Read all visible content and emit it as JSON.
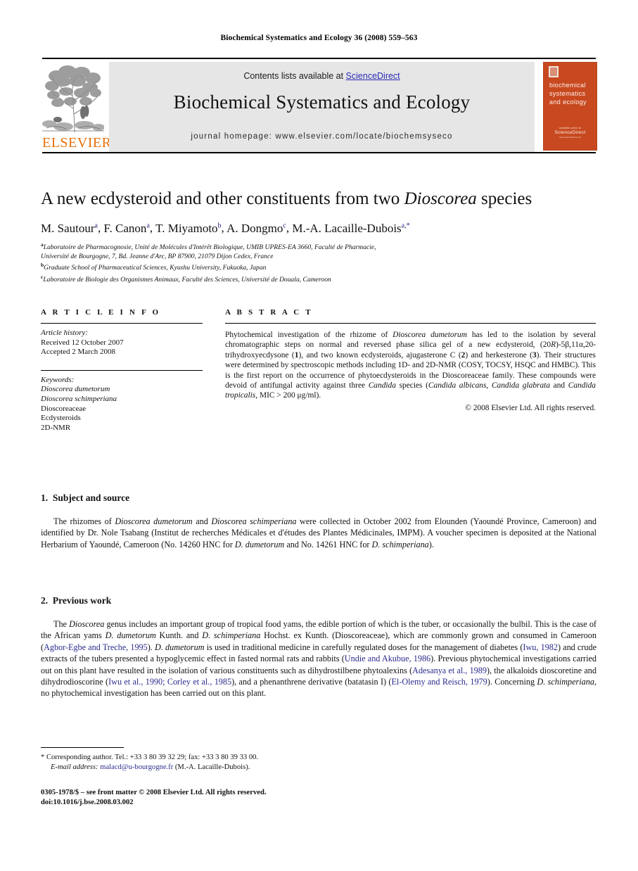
{
  "running_head": "Biochemical Systematics and Ecology 36 (2008) 559–563",
  "masthead": {
    "contents_prefix": "Contents lists available at ",
    "sciencedirect": "ScienceDirect",
    "journal_title": "Biochemical Systematics and Ecology",
    "homepage": "journal homepage: www.elsevier.com/locate/biochemsyseco",
    "publisher_name": "ELSEVIER",
    "cover": {
      "title": "biochemical systematics and ecology",
      "foot_top": "available online at",
      "foot_sd": "ScienceDirect",
      "foot_bottom": "www.sciencedirect.com"
    },
    "colors": {
      "elsevier_orange": "#e8700a",
      "panel_grey": "#e6e6e6",
      "link_blue": "#2b2bb5",
      "cover_orange": "#c8491f"
    }
  },
  "article": {
    "title_part1": "A new ecdysteroid and other constituents from two ",
    "title_italic": "Dioscorea",
    "title_part2": " species",
    "authors": [
      {
        "name": "M. Sautour",
        "sup": "a"
      },
      {
        "name": "F. Canon",
        "sup": "a"
      },
      {
        "name": "T. Miyamoto",
        "sup": "b"
      },
      {
        "name": "A. Dongmo",
        "sup": "c"
      },
      {
        "name": "M.-A. Lacaille-Dubois",
        "sup": "a,*"
      }
    ],
    "affiliations": [
      {
        "sup": "a",
        "text": "Laboratoire de Pharmacognosie, Unité de Molécules d'Intérêt Biologique, UMIB UPRES-EA 3660, Faculté de Pharmacie,"
      },
      {
        "sup": "",
        "text": "Université de Bourgogne, 7, Bd. Jeanne d'Arc, BP 87900, 21079 Dijon Cedex, France"
      },
      {
        "sup": "b",
        "text": "Graduate School of Pharmaceutical Sciences, Kyushu University, Fukuoka, Japan"
      },
      {
        "sup": "c",
        "text": "Laboratoire de Biologie des Organismes Animaux, Faculté des Sciences, Université de Douala, Cameroon"
      }
    ]
  },
  "article_info": {
    "heading": "A R T I C L E   I N F O",
    "history_label": "Article history:",
    "received": "Received 12 October 2007",
    "accepted": "Accepted 2 March 2008",
    "keywords_label": "Keywords:",
    "keywords": [
      "Dioscorea dumetorum",
      "Dioscorea schimperiana",
      "Dioscoreaceae",
      "Ecdysteroids",
      "2D-NMR"
    ],
    "keywords_italic": [
      true,
      true,
      false,
      false,
      false
    ]
  },
  "abstract": {
    "heading": "A B S T R A C T",
    "copyright": "© 2008 Elsevier Ltd. All rights reserved."
  },
  "sections": [
    {
      "number": "1.",
      "title": "Subject and source"
    },
    {
      "number": "2.",
      "title": "Previous work"
    }
  ],
  "footnote": {
    "line1": "* Corresponding author. Tel.: +33 3 80 39 32 29; fax: +33 3 80 39 33 00.",
    "email_label": "E-mail address:",
    "email": "malacd@u-bourgogne.fr",
    "email_owner": "(M.-A. Lacaille-Dubois)."
  },
  "issn": {
    "line1": "0305-1978/$ – see front matter © 2008 Elsevier Ltd. All rights reserved.",
    "line2": "doi:10.1016/j.bse.2008.03.002"
  }
}
